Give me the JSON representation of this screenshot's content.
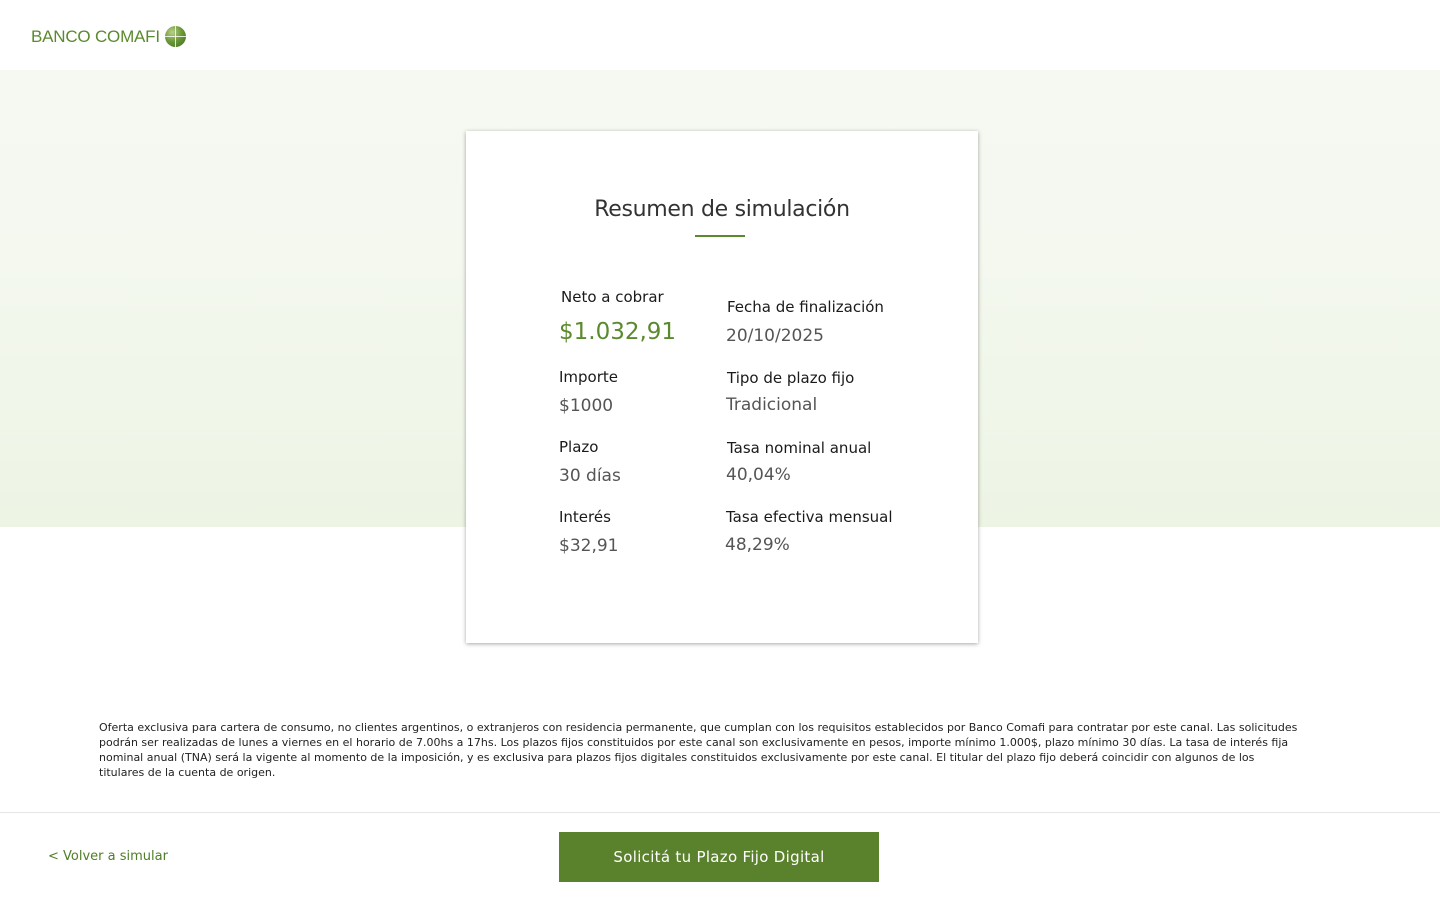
{
  "brand": {
    "name": "BANCO COMAFI",
    "logo_icon": "globe-icon",
    "color": "#5b8a2e"
  },
  "summary": {
    "title": "Resumen de simulación",
    "fields": {
      "neto": {
        "label": "Neto a cobrar",
        "value": "$1.032,91"
      },
      "fecha": {
        "label": "Fecha de finalización",
        "value": "20/10/2025"
      },
      "importe": {
        "label": "Importe",
        "value": "$1000"
      },
      "tipo": {
        "label": "Tipo de plazo fijo",
        "value": "Tradicional"
      },
      "plazo": {
        "label": "Plazo",
        "value": "30 días"
      },
      "tna": {
        "label": "Tasa nominal anual",
        "value": "40,04%"
      },
      "interes": {
        "label": "Interés",
        "value": "$32,91"
      },
      "tem": {
        "label": "Tasa efectiva mensual",
        "value": "48,29%"
      }
    }
  },
  "disclaimer": "Oferta exclusiva para cartera de consumo, no clientes argentinos, o extranjeros con residencia permanente, que cumplan con los requisitos establecidos por Banco Comafi para contratar por este canal. Las solicitudes podrán ser realizadas de lunes a viernes en el horario de 7.00hs a 17hs. Los plazos fijos constituidos por este canal son exclusivamente en pesos, importe mínimo 1.000$, plazo mínimo 30 días. La tasa de interés fija nominal anual (TNA) será la vigente al momento de la imposición, y es exclusiva para plazos fijos digitales constituidos exclusivamente por este canal. El titular del plazo fijo deberá coincidir con algunos de los titulares de la cuenta de origen.",
  "footer": {
    "back_label": "< Volver a simular",
    "cta_label": "Solicitá tu Plazo Fijo Digital"
  }
}
